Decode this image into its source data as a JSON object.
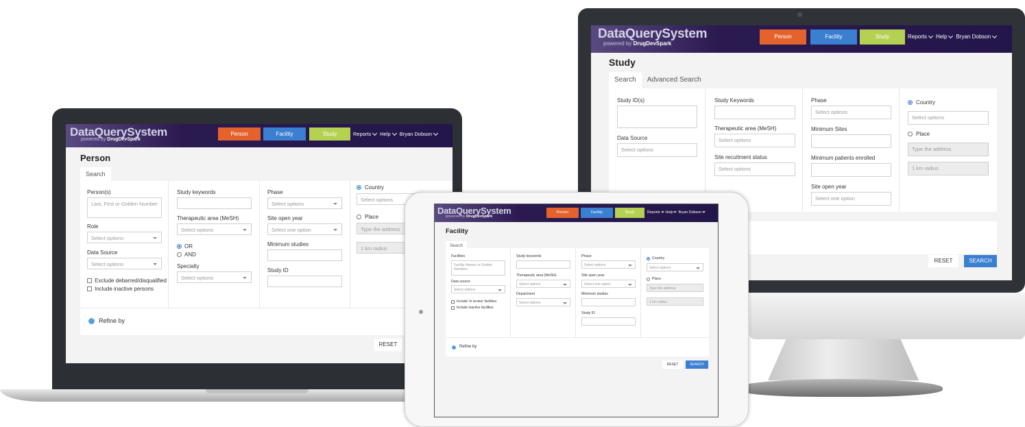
{
  "app": {
    "logo_main": "DataQuerySystem",
    "logo_powered": "powered by",
    "logo_brand": "DrugDevSpark",
    "nav": {
      "person": "Person",
      "facility": "Facility",
      "study": "Study",
      "reports": "Reports",
      "help": "Help",
      "user": "Bryan Dobson"
    },
    "colors": {
      "header": "#2d1b55",
      "person": "#e4632d",
      "facility": "#3b7fd0",
      "study": "#b5d152",
      "search_button": "#3b7fd0"
    }
  },
  "study": {
    "title": "Study",
    "tabs": [
      "Search",
      "Advanced Search"
    ],
    "col1": {
      "study_ids_label": "Study ID(s)",
      "data_source_label": "Data Source",
      "data_source_ph": "Select options"
    },
    "col2": {
      "keywords_label": "Study Keywords",
      "therapeutic_label": "Therapeutic area (MeSH)",
      "therapeutic_ph": "Select options",
      "recruitment_label": "Site recuitment status",
      "recruitment_ph": "Select options"
    },
    "col3": {
      "phase_label": "Phase",
      "phase_ph": "Select options",
      "min_sites_label": "Minimum Sites",
      "min_patients_label": "Minimum patients enrolled",
      "open_year_label": "Site open year",
      "open_year_ph": "Select one option"
    },
    "col4": {
      "country_label": "Country",
      "country_ph": "Select options",
      "place_label": "Place",
      "address_ph": "Type the address",
      "radius": "1 km radius"
    },
    "reset": "RESET",
    "search": "SEARCH"
  },
  "person": {
    "title": "Person",
    "tab": "Search",
    "col1": {
      "persons_label": "Person(s)",
      "persons_ph": "Last, First or Golden Number",
      "role_label": "Role",
      "role_ph": "Select options",
      "data_source_label": "Data Source",
      "data_source_ph": "Select options",
      "exclude_debarred": "Exclude debarred/disqualified",
      "include_inactive": "Include inactive persons"
    },
    "col2": {
      "keywords_label": "Study keywords",
      "therapeutic_label": "Therapeutic area (MeSH)",
      "therapeutic_ph": "Select options",
      "or_label": "OR",
      "and_label": "AND",
      "specialty_label": "Specialty",
      "specialty_ph": "Select options"
    },
    "col3": {
      "phase_label": "Phase",
      "phase_ph": "Select options",
      "open_year_label": "Site open year",
      "open_year_ph": "Select one option",
      "min_studies_label": "Minimum studies",
      "study_id_label": "Study ID"
    },
    "col4": {
      "country_label": "Country",
      "country_ph": "Select options",
      "place_label": "Place",
      "address_ph": "Type the address",
      "radius": "1 km radius"
    },
    "refine": "Refine by",
    "reset": "RESET"
  },
  "facility": {
    "title": "Facility",
    "tab": "Search",
    "col1": {
      "facilities_label": "Facilities",
      "facilities_ph": "Facility Names or Golden Numbers",
      "data_source_label": "Data source",
      "data_source_ph": "Select options",
      "include_review": "Include 'in review' facilities",
      "include_inactive": "Include inactive facilities"
    },
    "col2": {
      "keywords_label": "Study keywords",
      "therapeutic_label": "Therapeutic area (MeSH)",
      "therapeutic_ph": "Select options",
      "department_label": "Department",
      "department_ph": "Select options"
    },
    "col3": {
      "phase_label": "Phase",
      "phase_ph": "Select options",
      "open_year_label": "Site open year",
      "open_year_ph": "Select one option",
      "min_studies_label": "Minimum studies",
      "study_id_label": "Study ID"
    },
    "col4": {
      "country_label": "Country",
      "country_ph": "Select options",
      "place_label": "Place",
      "address_ph": "Type the address",
      "radius": "1 km radius"
    },
    "refine": "Refine by",
    "reset": "RESET",
    "search": "SEARCH"
  }
}
